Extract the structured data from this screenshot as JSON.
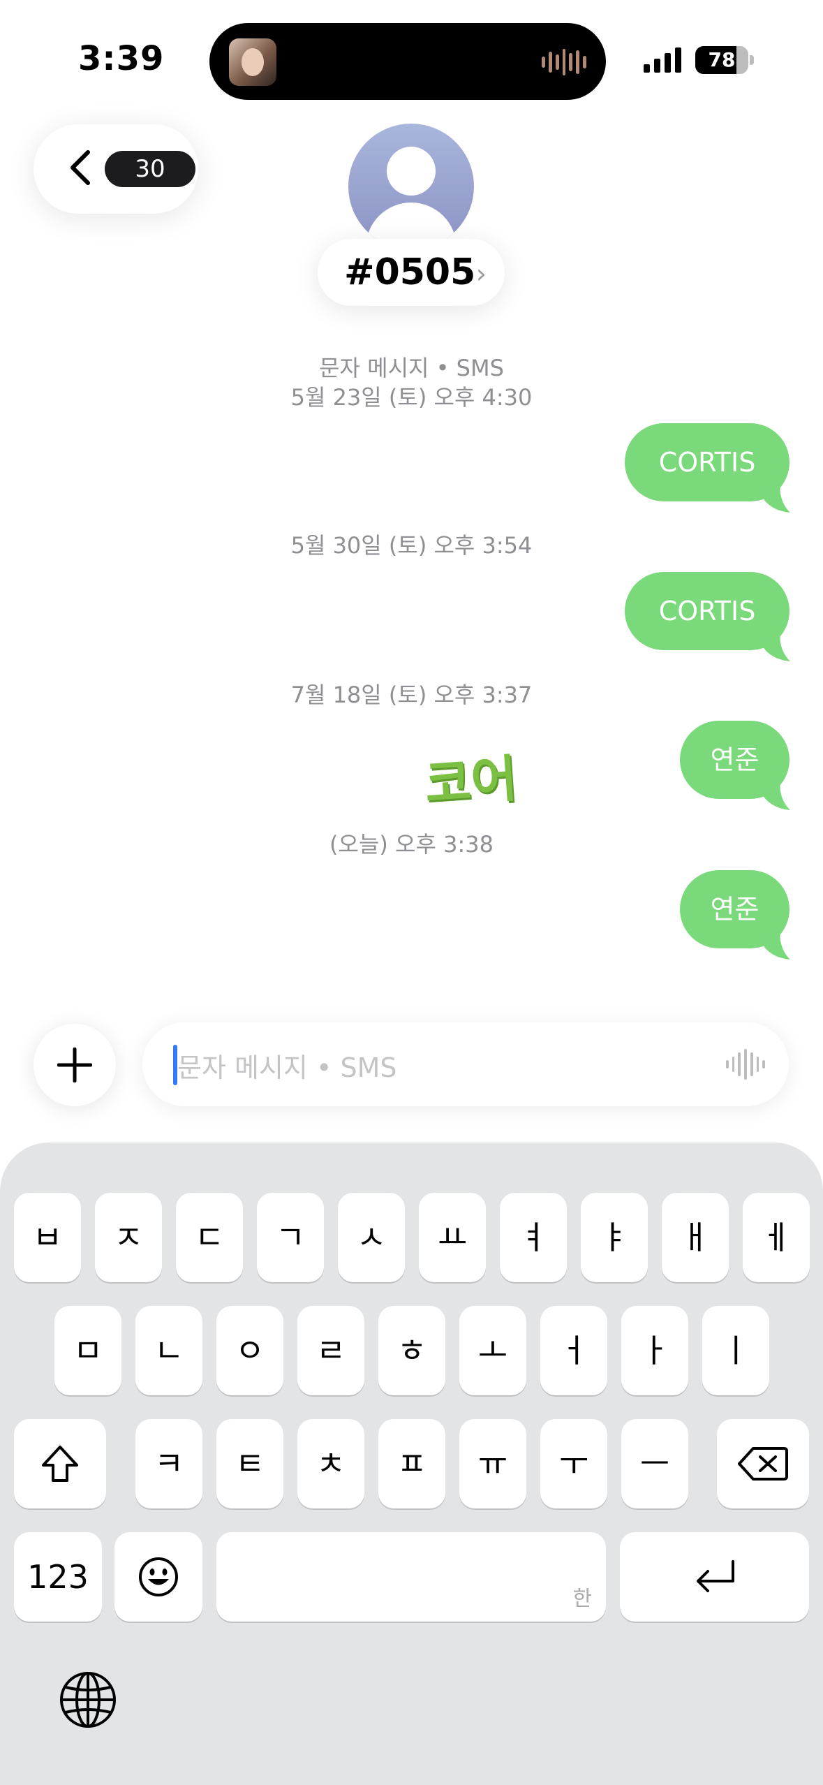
{
  "status_bar": {
    "time": "3:39",
    "battery": "78",
    "battery_level": 0.78
  },
  "header": {
    "back_count": "30",
    "contact_name": "#0505",
    "name_chevron": "›"
  },
  "messages": [
    {
      "meta": [
        "문자 메시지 • SMS",
        "5월 23일 (토) 오후 4:30"
      ],
      "text": "CORTIS"
    },
    {
      "meta": [
        "5월 30일 (토) 오후 3:54"
      ],
      "text": "CORTIS"
    },
    {
      "meta": [
        "7월 18일 (토) 오후 3:37"
      ],
      "text": "연준",
      "sticker": "코어"
    },
    {
      "meta": [
        "(오늘) 오후 3:38"
      ],
      "text": "연준"
    }
  ],
  "input": {
    "placeholder": "문자 메시지 • SMS"
  },
  "keyboard": {
    "row1": [
      "ㅂ",
      "ㅈ",
      "ㄷ",
      "ㄱ",
      "ㅅ",
      "ㅛ",
      "ㅕ",
      "ㅑ",
      "ㅐ",
      "ㅔ"
    ],
    "row2": [
      "ㅁ",
      "ㄴ",
      "ㅇ",
      "ㄹ",
      "ㅎ",
      "ㅗ",
      "ㅓ",
      "ㅏ",
      "ㅣ"
    ],
    "row3": [
      "ㅋ",
      "ㅌ",
      "ㅊ",
      "ㅍ",
      "ㅠ",
      "ㅜ",
      "ㅡ"
    ],
    "numbers_label": "123",
    "space_hint": "한",
    "icons": [
      "shift-icon",
      "delete-icon",
      "emoji-icon",
      "return-icon",
      "globe-icon"
    ]
  },
  "colors": {
    "bubble": "#7ad97a",
    "accent": "#3478f6",
    "keyboard_bg": "#e3e4e6"
  }
}
